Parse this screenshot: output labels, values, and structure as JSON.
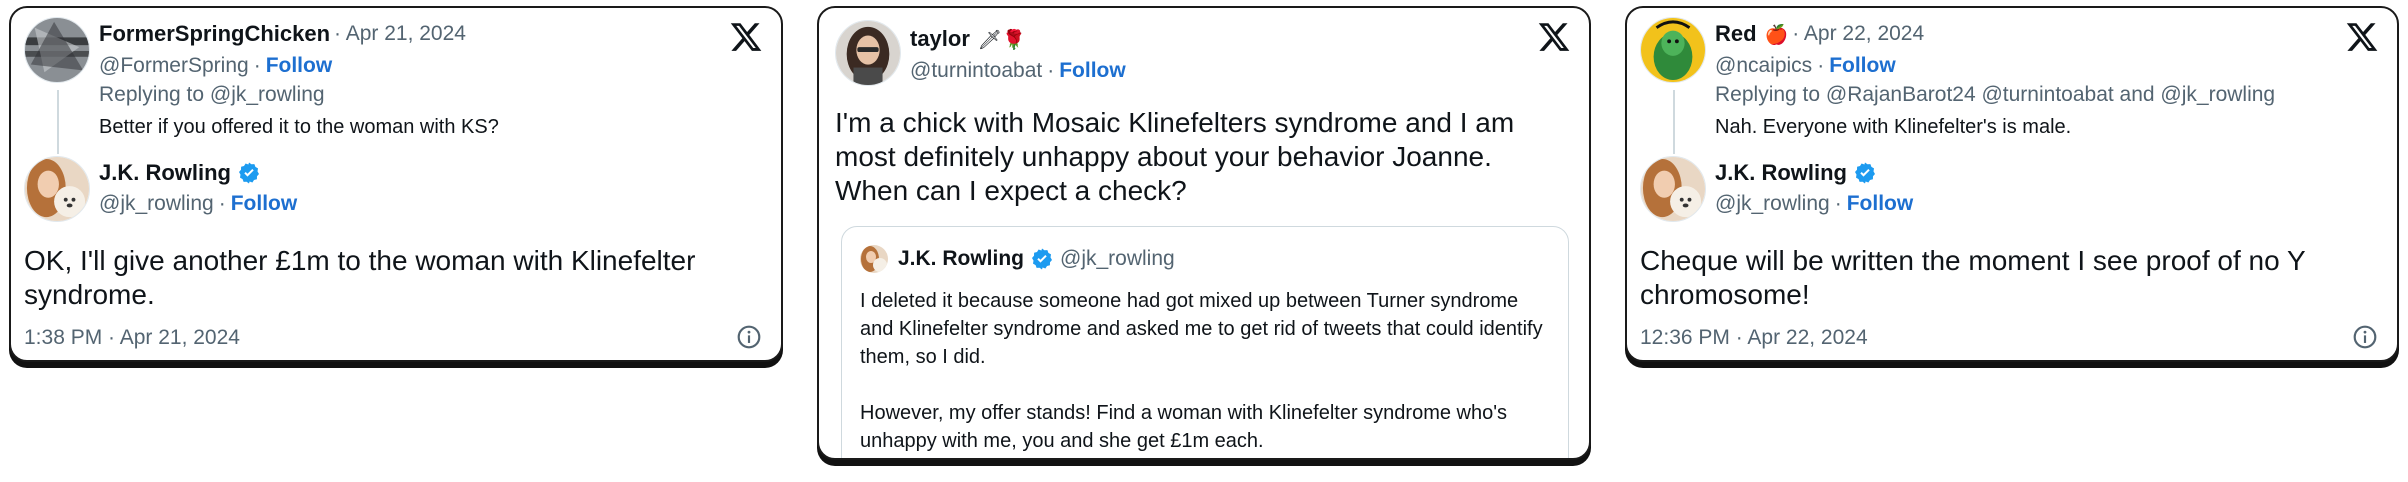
{
  "tweets": [
    {
      "reply": {
        "name": "FormerSpringChicken",
        "meta": "· Apr 21, 2024",
        "handle": "@FormerSpring",
        "follow_label": "Follow",
        "replying_to": "Replying to @jk_rowling",
        "text": "Better if you offered it to the woman with KS?"
      },
      "main": {
        "name": "J.K. Rowling",
        "handle": "@jk_rowling",
        "follow_label": "Follow",
        "text": "OK, I'll give another £1m to the woman with Klinefelter syndrome.",
        "time": "1:38 PM · Apr 21, 2024"
      }
    },
    {
      "main": {
        "name": "taylor",
        "name_emoji": "🗡🌹",
        "handle": "@turnintoabat",
        "follow_label": "Follow",
        "text": "I'm a chick with Mosaic Klinefelters syndrome and I am most definitely unhappy about your behavior Joanne. When can I expect a check?"
      },
      "quote": {
        "name": "J.K. Rowling",
        "handle": "@jk_rowling",
        "paragraph_1": "I deleted it because someone had got mixed up between Turner syndrome and Klinefelter syndrome and asked me to get rid of tweets that could identify them, so I did.",
        "paragraph_2": "However, my offer stands! Find a woman with Klinefelter syndrome who's unhappy with me, you and she get £1m each."
      }
    },
    {
      "reply": {
        "name": "Red",
        "name_emoji": "🍎",
        "meta": "· Apr 22, 2024",
        "handle": "@ncaipics",
        "follow_label": "Follow",
        "replying_to": "Replying to @RajanBarot24 @turnintoabat and @jk_rowling",
        "text": "Nah.  Everyone with Klinefelter's is male."
      },
      "main": {
        "name": "J.K. Rowling",
        "handle": "@jk_rowling",
        "follow_label": "Follow",
        "text": "Cheque will be written the moment I see proof of no Y chromosome!",
        "time": "12:36 PM · Apr 22, 2024"
      }
    }
  ],
  "icons": {
    "x_logo": "x-logo-icon",
    "verified": "verified-badge-icon",
    "info": "info-icon"
  },
  "colors": {
    "follow": "#1d6fd0",
    "secondary_text": "#536471",
    "verified": "#1d9bf0"
  }
}
